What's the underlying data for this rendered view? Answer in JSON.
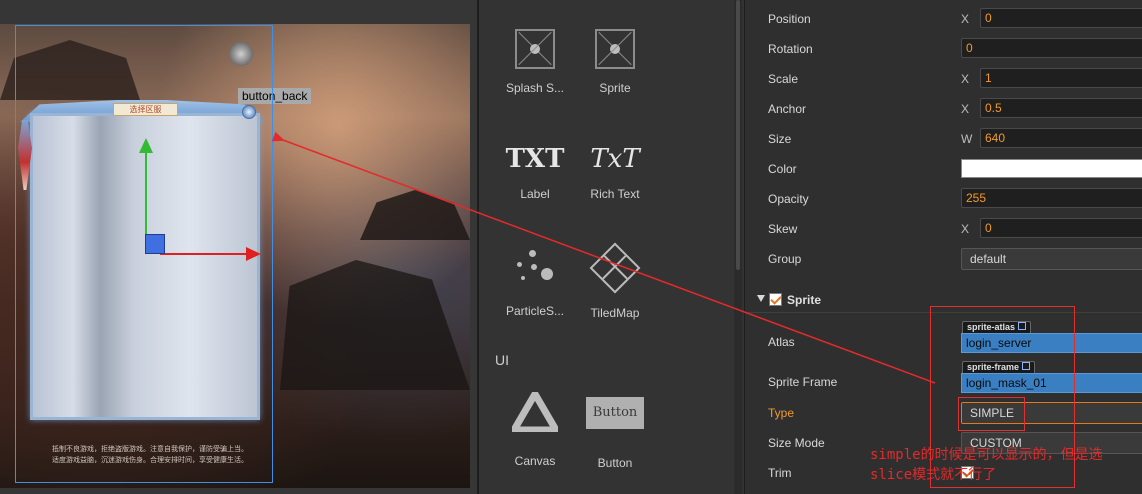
{
  "scene": {
    "node_label": "button_back",
    "dialog_title": "选择区服",
    "footer_text": "抵制不良游戏，拒绝盗版游戏。注意自我保护，谨防受骗上当。适度游戏益脑，沉迷游戏伤身。合理安排时间，享受健康生活。"
  },
  "assets": {
    "widgets": [
      {
        "label": "Splash S...",
        "icon": "sprite-icon"
      },
      {
        "label": "Sprite",
        "icon": "sprite-icon"
      },
      {
        "label": "Label",
        "icon": "TXT"
      },
      {
        "label": "Rich Text",
        "icon": "TxT"
      },
      {
        "label": "ParticleS...",
        "icon": "particle-icon"
      },
      {
        "label": "TiledMap",
        "icon": "tiledmap-icon"
      },
      {
        "label": "Canvas",
        "icon": "canvas-icon"
      },
      {
        "label": "Button",
        "icon": "Button"
      }
    ],
    "ui_section": "UI"
  },
  "props": {
    "position": {
      "label": "Position",
      "axis": "X",
      "value": "0"
    },
    "rotation": {
      "label": "Rotation",
      "value": "0"
    },
    "scale": {
      "label": "Scale",
      "axis": "X",
      "value": "1"
    },
    "anchor": {
      "label": "Anchor",
      "axis": "X",
      "value": "0.5"
    },
    "size": {
      "label": "Size",
      "axis": "W",
      "value": "640"
    },
    "color": {
      "label": "Color",
      "value": "#ffffff"
    },
    "opacity": {
      "label": "Opacity",
      "value": "255"
    },
    "skew": {
      "label": "Skew",
      "axis": "X",
      "value": "0"
    },
    "group": {
      "label": "Group",
      "value": "default"
    },
    "sprite_section": {
      "title": "Sprite",
      "checked": true
    },
    "atlas": {
      "label": "Atlas",
      "tag": "sprite-atlas",
      "value": "login_server"
    },
    "sprite_frame": {
      "label": "Sprite Frame",
      "tag": "sprite-frame",
      "value": "login_mask_01"
    },
    "type": {
      "label": "Type",
      "value": "SIMPLE"
    },
    "size_mode": {
      "label": "Size Mode",
      "value": "CUSTOM"
    },
    "trim": {
      "label": "Trim",
      "checked": true
    }
  },
  "annotation": {
    "text": "simple的时候是可以显示的，但是选slice模式就不行了",
    "color": "#e42a2a"
  }
}
